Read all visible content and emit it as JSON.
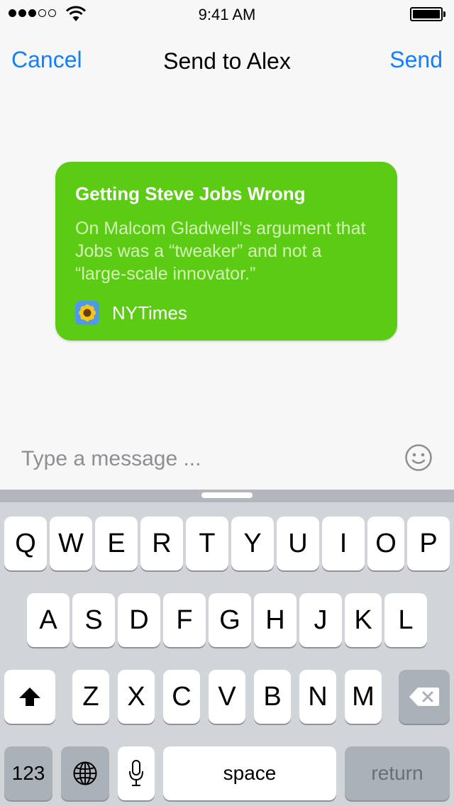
{
  "status_bar": {
    "time": "9:41 AM",
    "signal_bars_filled": 3,
    "signal_bars_total": 5
  },
  "nav": {
    "cancel_label": "Cancel",
    "title": "Send to Alex",
    "send_label": "Send",
    "accent_color": "#157efb"
  },
  "card": {
    "title": "Getting Steve Jobs Wrong",
    "description": "On Malcom Gladwell’s argument that Jobs was a “tweaker” and not a “large-scale innovator.”",
    "source_name": "NYTimes",
    "source_icon": "sunflower-icon",
    "color": "#5ccb14"
  },
  "message": {
    "placeholder": "Type a message ...",
    "emoji_icon": "smiley-icon"
  },
  "keyboard": {
    "row1": [
      "Q",
      "W",
      "E",
      "R",
      "T",
      "Y",
      "U",
      "I",
      "O",
      "P"
    ],
    "row2": [
      "A",
      "S",
      "D",
      "F",
      "G",
      "H",
      "J",
      "K",
      "L"
    ],
    "row3": [
      "Z",
      "X",
      "C",
      "V",
      "B",
      "N",
      "M"
    ],
    "shift_icon": "shift-arrow-icon",
    "delete_icon": "delete-backspace-icon",
    "numbers_label": "123",
    "globe_icon": "globe-icon",
    "mic_icon": "microphone-icon",
    "space_label": "space",
    "return_label": "return"
  }
}
